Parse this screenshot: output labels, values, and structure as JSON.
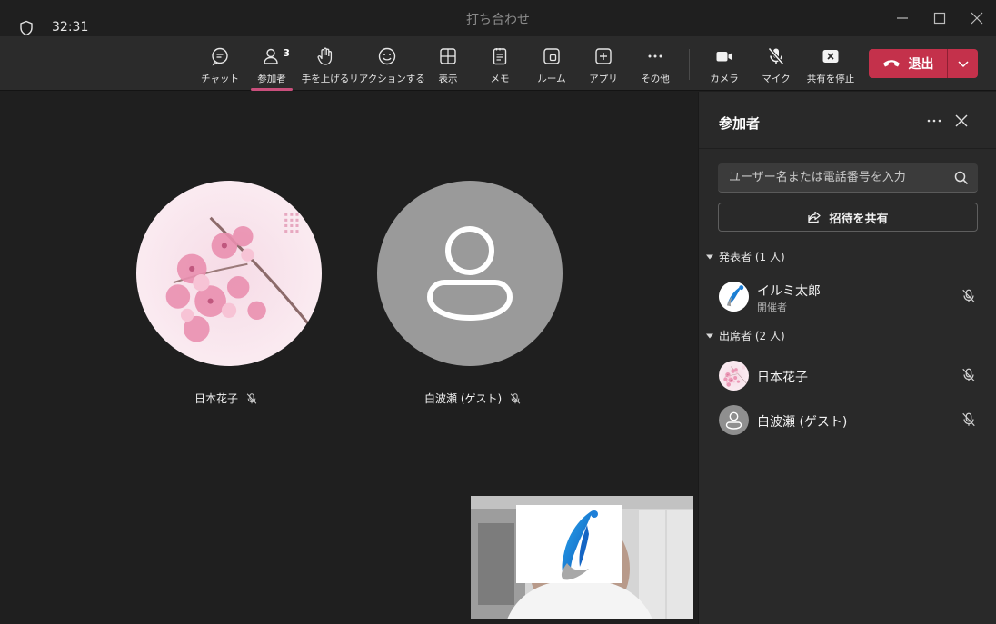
{
  "window": {
    "title": "打ち合わせ"
  },
  "toolbar": {
    "timer": "32:31",
    "participant_count": "3",
    "items": [
      {
        "label": "チャット"
      },
      {
        "label": "参加者"
      },
      {
        "label": "手を上げる"
      },
      {
        "label": "リアクションする"
      },
      {
        "label": "表示"
      },
      {
        "label": "メモ"
      },
      {
        "label": "ルーム"
      },
      {
        "label": "アプリ"
      },
      {
        "label": "その他"
      },
      {
        "label": "カメラ"
      },
      {
        "label": "マイク"
      },
      {
        "label": "共有を停止"
      }
    ],
    "leave_label": "退出"
  },
  "stage": {
    "tiles": [
      {
        "name": "日本花子"
      },
      {
        "name": "白波瀬 (ゲスト)"
      }
    ]
  },
  "panel": {
    "title": "参加者",
    "search_placeholder": "ユーザー名または電話番号を入力",
    "invite_label": "招待を共有",
    "presenters_header": "発表者 (1 人)",
    "attendees_header": "出席者 (2 人)",
    "presenters": [
      {
        "name": "イルミ太郎",
        "role": "開催者"
      }
    ],
    "attendees": [
      {
        "name": "日本花子"
      },
      {
        "name": "白波瀬 (ゲスト)"
      }
    ]
  },
  "colors": {
    "leave_button": "#c4314b",
    "active_underline": "#c94f7c",
    "panel_bg": "#292929",
    "toolbar_bg": "#2b2b2b"
  }
}
